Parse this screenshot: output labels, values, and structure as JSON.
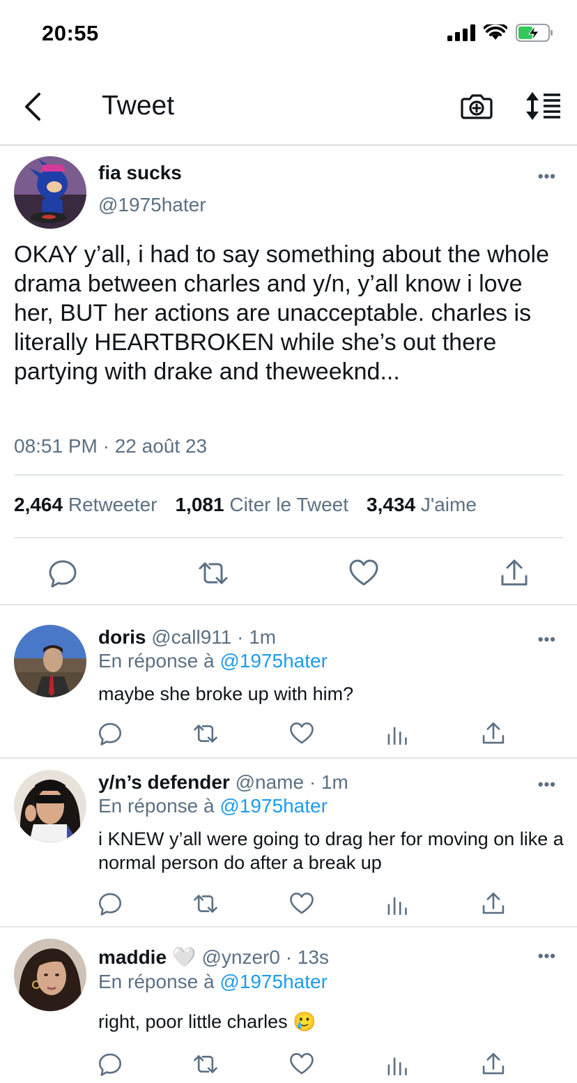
{
  "status_bar": {
    "time": "20:55"
  },
  "nav": {
    "title": "Tweet"
  },
  "tweet": {
    "author_name": "fia sucks",
    "author_handle": "@1975hater",
    "text": "OKAY y’all, i had to say something about the whole drama between charles and y/n, y’all know i love her, BUT her actions are unacceptable. charles is literally HEARTBROKEN while she’s out there partying with drake and theweeknd...",
    "timestamp": "08:51 PM · 22 août 23",
    "stats": {
      "retweets_count": "2,464",
      "retweets_label": "Retweeter",
      "quotes_count": "1,081",
      "quotes_label": "Citer le Tweet",
      "likes_count": "3,434",
      "likes_label": "J'aime"
    }
  },
  "replies": [
    {
      "name": "doris",
      "handle": "@call911",
      "time": "· 1m",
      "reply_prefix": "En réponse à",
      "reply_mention": "@1975hater",
      "text": "maybe she broke up with him?"
    },
    {
      "name": "y/n’s defender",
      "handle": "@name",
      "time": "· 1m",
      "reply_prefix": "En réponse à",
      "reply_mention": "@1975hater",
      "text": "i KNEW y’all were going to drag her for moving on like a normal person do after a break up"
    },
    {
      "name": "maddie 🤍",
      "handle": "@ynzer0",
      "time": "· 13s",
      "reply_prefix": "En réponse à",
      "reply_mention": "@1975hater",
      "text": "right, poor little charles 🥲"
    }
  ],
  "icons": {
    "back": "chevron-left-icon",
    "camera": "camera-icon",
    "sort": "sort-icon",
    "more": "more-dots-icon",
    "reply": "comment-icon",
    "retweet": "retweet-icon",
    "like": "heart-icon",
    "analytics": "bar-chart-icon",
    "share": "share-icon"
  },
  "colors": {
    "accent": "#1d9bf0",
    "secondary_text": "#5b7083",
    "text": "#0f1419"
  }
}
